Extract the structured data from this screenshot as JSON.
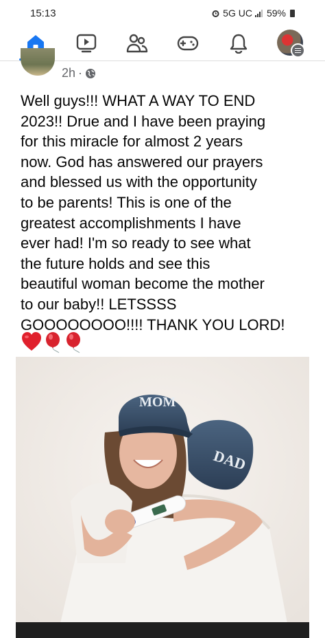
{
  "status": {
    "time": "15:13",
    "network": "5G UC",
    "battery": "59%"
  },
  "nav": {
    "items": [
      {
        "name": "home",
        "active": true
      },
      {
        "name": "video"
      },
      {
        "name": "friends"
      },
      {
        "name": "gaming"
      },
      {
        "name": "notifications"
      },
      {
        "name": "profile-menu"
      }
    ],
    "accent_color": "#1877f2"
  },
  "post": {
    "time": "2h",
    "separator": "·",
    "audience_icon": "globe-icon",
    "text": "Well guys!!! WHAT A WAY TO END\n2023!! Drue and I have been praying\nfor this miracle for almost 2 years\nnow. God has answered our prayers\nand blessed us with the opportunity\nto be parents! This is one of the\ngreatest accomplishments I have\never had! I'm so ready to see what\nthe future holds and see this\nbeautiful woman become the mother\nto our baby!! LETSSSS\nGOOOOOOOO!!!! THANK YOU LORD!",
    "emojis": [
      "red-heart",
      "red-balloon",
      "red-balloon"
    ],
    "photo": {
      "cap_left_text": "MOM",
      "cap_right_text": "DAD"
    }
  }
}
